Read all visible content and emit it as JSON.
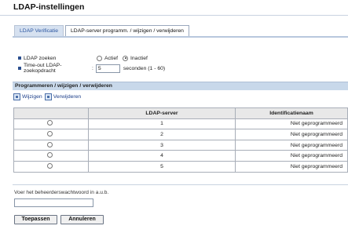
{
  "page": {
    "title": "LDAP-instellingen"
  },
  "tabs": [
    {
      "label": "LDAP Verificatie",
      "active": false
    },
    {
      "label": "LDAP-server programm. / wijzigen / verwijderen",
      "active": true
    }
  ],
  "ldap_search": {
    "label": "LDAP zoeken",
    "options": [
      "Actief",
      "Inactief"
    ],
    "selected": "Inactief"
  },
  "timeout": {
    "label": "Time-out LDAP-zoekopdracht",
    "separator": ":",
    "value": "5",
    "unit": "seconden (1 - 60)"
  },
  "section": {
    "title": "Programmeren / wijzigen / verwijderen",
    "actions": [
      "Wijzigen",
      "Verwijderen"
    ]
  },
  "table": {
    "columns": [
      "",
      "LDAP-server",
      "Identificatienaam"
    ],
    "rows": [
      {
        "server": "1",
        "ident": "Niet geprogrammeerd"
      },
      {
        "server": "2",
        "ident": "Niet geprogrammeerd"
      },
      {
        "server": "3",
        "ident": "Niet geprogrammeerd"
      },
      {
        "server": "4",
        "ident": "Niet geprogrammeerd"
      },
      {
        "server": "5",
        "ident": "Niet geprogrammeerd"
      }
    ]
  },
  "password": {
    "label": "Voer het beheerderswachtwoord in a.u.b.",
    "value": ""
  },
  "buttons": {
    "apply": "Toepassen",
    "cancel": "Annuleren"
  },
  "colors": {
    "accent": "#2b4f8f",
    "section_bar": "#c8d8ea",
    "tab_inactive": "#d6e1f0"
  }
}
